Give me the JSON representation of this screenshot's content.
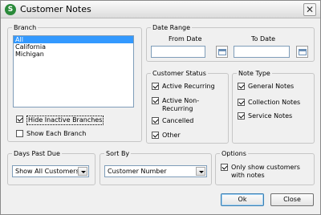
{
  "window": {
    "title": "Customer Notes",
    "icon_letter": "S"
  },
  "branch": {
    "legend": "Branch",
    "items": [
      "All",
      "California",
      "Michigan"
    ],
    "selected_index": 0,
    "hide_inactive": {
      "label": "Hide Inactive Branches",
      "checked": true
    },
    "show_each": {
      "label": "Show Each Branch",
      "checked": false
    }
  },
  "date_range": {
    "legend": "Date Range",
    "from_label": "From Date",
    "to_label": "To Date",
    "from_value": "",
    "to_value": ""
  },
  "customer_status": {
    "legend": "Customer Status",
    "active_recurring": {
      "label": "Active Recurring",
      "checked": true
    },
    "active_non_recurring": {
      "label": "Active Non-Recurring",
      "checked": true
    },
    "cancelled": {
      "label": "Cancelled",
      "checked": true
    },
    "other": {
      "label": "Other",
      "checked": true
    }
  },
  "note_type": {
    "legend": "Note Type",
    "general": {
      "label": "General Notes",
      "checked": true
    },
    "collection": {
      "label": "Collection Notes",
      "checked": true
    },
    "service": {
      "label": "Service Notes",
      "checked": true
    }
  },
  "days_past_due": {
    "legend": "Days Past Due",
    "value": "Show All Customers"
  },
  "sort_by": {
    "legend": "Sort By",
    "value": "Customer Number"
  },
  "options": {
    "legend": "Options",
    "only_show_with_notes": {
      "label": "Only show customers with notes",
      "checked": true
    }
  },
  "buttons": {
    "ok": "Ok",
    "close": "Close"
  }
}
